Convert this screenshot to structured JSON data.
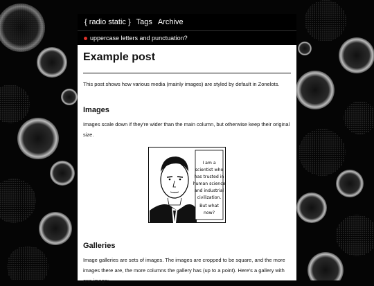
{
  "nav": {
    "brand": "{ radio static }",
    "links": [
      "Tags",
      "Archive"
    ]
  },
  "subnav": {
    "text": "uppercase letters and punctuation?",
    "dot_color": "#e0322a"
  },
  "post": {
    "title": "Example post",
    "intro": "This post shows how various media (mainly images) are styled by default in Zonelots.",
    "sections": [
      {
        "heading": "Images",
        "body": "Images scale down if they're wider than the main column, but otherwise keep their original size."
      },
      {
        "heading": "Galleries",
        "body": "Image galleries are sets of images. The images are cropped to be square, and the more images there are, the more columns the gallery has (up to a point). Here's a gallery with one image:"
      }
    ],
    "comic_lines": [
      "I am a",
      "scientist who",
      "has trusted in",
      "human science",
      "and industrial",
      "civilization.",
      "But what",
      "now?"
    ]
  }
}
